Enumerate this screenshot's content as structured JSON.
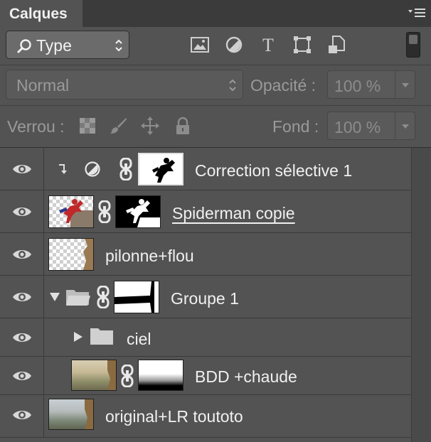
{
  "panel": {
    "tab_title": "Calques",
    "menu_icon": "panel-menu-icon"
  },
  "filter": {
    "selected": "Type",
    "icons": [
      "image-filter-icon",
      "adjustment-filter-icon",
      "type-filter-icon",
      "shape-filter-icon",
      "smart-object-filter-icon"
    ],
    "toggle": "filter-toggle"
  },
  "blend": {
    "mode": "Normal",
    "opacity_label": "Opacité :",
    "opacity_value": "100 %"
  },
  "lock": {
    "label": "Verrou :",
    "icons": [
      "lock-transparent-icon",
      "lock-image-icon",
      "lock-position-icon",
      "lock-all-icon"
    ],
    "fill_label": "Fond :",
    "fill_value": "100 %"
  },
  "layers": [
    {
      "name": "Correction sélective 1",
      "type": "adjustment",
      "visible": true,
      "clipped": true
    },
    {
      "name": "Spiderman copie",
      "type": "smart-masked",
      "visible": true,
      "linked": true
    },
    {
      "name": "pilonne+flou",
      "type": "pixel",
      "visible": true
    },
    {
      "name": "Groupe 1",
      "type": "group",
      "visible": true,
      "expanded": true
    },
    {
      "name": "ciel",
      "type": "group",
      "visible": true,
      "expanded": false
    },
    {
      "name": "BDD +chaude",
      "type": "masked",
      "visible": true
    },
    {
      "name": "original+LR toutoto",
      "type": "pixel",
      "visible": true
    }
  ],
  "colors": {
    "panel_bg": "#535353",
    "tab_bg": "#3b3b3b",
    "text": "#f0f0f0",
    "dim_text": "#9a9a9a"
  }
}
